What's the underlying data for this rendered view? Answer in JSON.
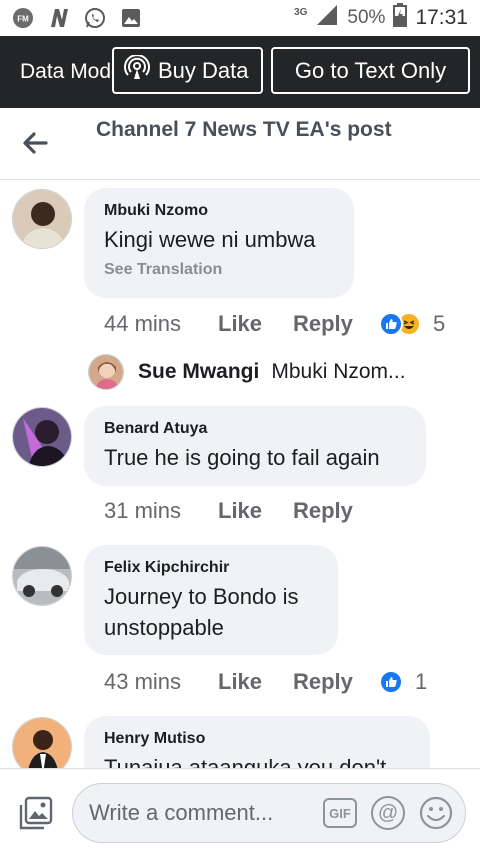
{
  "status_bar": {
    "network": "3G",
    "battery": "50%",
    "time": "17:31"
  },
  "data_bar": {
    "mode_label": "Data Mode",
    "buy_data_label": "Buy Data",
    "text_only_label": "Go to Text Only"
  },
  "header": {
    "title": "Channel 7 News TV EA's post"
  },
  "comments": [
    {
      "author": "Mbuki Nzomo",
      "text": "Kingi wewe ni umbwa",
      "see_translation": "See Translation",
      "time": "44 mins",
      "like": "Like",
      "reply": "Reply",
      "reaction_count": "5",
      "reactions": [
        "like",
        "haha"
      ],
      "reply_preview": {
        "author": "Sue Mwangi",
        "snippet": "Mbuki Nzom..."
      }
    },
    {
      "author": "Benard Atuya",
      "text": "True he is going to fail again",
      "time": "31 mins",
      "like": "Like",
      "reply": "Reply"
    },
    {
      "author": "Felix Kipchirchir",
      "text": "Journey to Bondo is unstoppable",
      "time": "43 mins",
      "like": "Like",
      "reply": "Reply",
      "reaction_count": "1",
      "reactions": [
        "like"
      ]
    },
    {
      "author": "Henry Mutiso",
      "text": "Tunajua ataanguka you don't"
    }
  ],
  "composer": {
    "placeholder": "Write a comment...",
    "gif_label": "GIF",
    "at_label": "@"
  },
  "colors": {
    "data_bar_bg": "#242526",
    "bubble_bg": "#f0f2f5",
    "like_blue": "#1877f2",
    "haha_yellow": "#f7b125"
  }
}
